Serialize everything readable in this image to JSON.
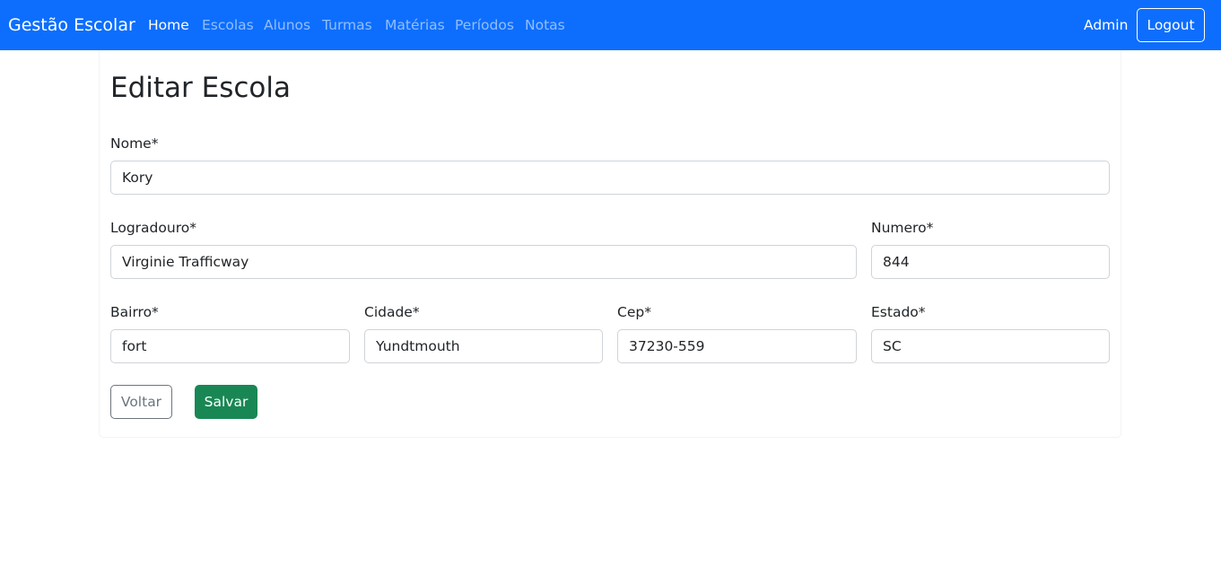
{
  "navbar": {
    "brand": "Gestão Escolar",
    "links": [
      {
        "label": "Home",
        "active": true
      },
      {
        "label": "Escolas",
        "active": false
      },
      {
        "label": "Alunos",
        "active": false
      },
      {
        "label": "Turmas",
        "active": false
      },
      {
        "label": "Matérias",
        "active": false
      },
      {
        "label": "Períodos",
        "active": false
      },
      {
        "label": "Notas",
        "active": false
      }
    ],
    "user": "Admin",
    "logout_label": "Logout"
  },
  "page": {
    "title": "Editar Escola"
  },
  "form": {
    "nome": {
      "label": "Nome*",
      "value": "Kory"
    },
    "logradouro": {
      "label": "Logradouro*",
      "value": "Virginie Trafficway"
    },
    "numero": {
      "label": "Numero*",
      "value": "844"
    },
    "bairro": {
      "label": "Bairro*",
      "value": "fort"
    },
    "cidade": {
      "label": "Cidade*",
      "value": "Yundtmouth"
    },
    "cep": {
      "label": "Cep*",
      "value": "37230-559"
    },
    "estado": {
      "label": "Estado*",
      "value": "SC"
    }
  },
  "actions": {
    "back_label": "Voltar",
    "save_label": "Salvar"
  },
  "colors": {
    "navbar_bg": "#0d6efd",
    "save_button_bg": "#198754",
    "back_button_border": "#6c757d"
  }
}
